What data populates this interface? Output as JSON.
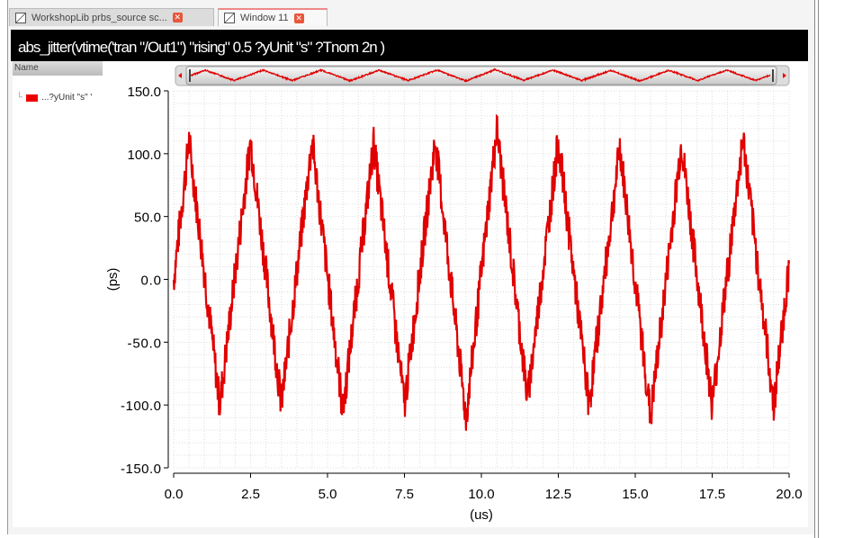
{
  "tabs": [
    {
      "label": "WorkshopLib prbs_source sc...",
      "active": false
    },
    {
      "label": "Window 11",
      "active": true
    }
  ],
  "title": "abs_jitter(vtime('tran \"/Out1\") \"rising\" 0.5 ?yUnit \"s\" ?Tnom 2n )",
  "legend_panel": {
    "header": "Name",
    "items": [
      {
        "label": "...?yUnit \"s\" '",
        "color": "#e00000"
      }
    ]
  },
  "chart_data": {
    "type": "line",
    "title": "abs_jitter(vtime('tran \"/Out1\") \"rising\" 0.5 ?yUnit \"s\" ?Tnom 2n )",
    "xlabel": "(us)",
    "ylabel": "(ps)",
    "xlim": [
      0,
      20
    ],
    "ylim": [
      -150,
      150
    ],
    "xticks": [
      "0.0",
      "2.5",
      "5.0",
      "7.5",
      "10.0",
      "12.5",
      "15.0",
      "17.5",
      "20.0"
    ],
    "yticks": [
      "150.0",
      "100.0",
      "50.0",
      "0.0",
      "-50.0",
      "-100.0",
      "-150.0"
    ],
    "grid": true,
    "series": [
      {
        "name": "...?yUnit \"s\" '",
        "color": "#e00000",
        "envelope_x": [
          0,
          0.5,
          1.5,
          2.5,
          3.5,
          4.5,
          5.5,
          6.5,
          7.5,
          8.5,
          9.5,
          10.5,
          11.5,
          12.5,
          13.5,
          14.5,
          15.5,
          16.5,
          17.5,
          18.5,
          19.5,
          20
        ],
        "envelope_y": [
          0,
          110,
          -100,
          110,
          -100,
          110,
          -105,
          108,
          -100,
          110,
          -110,
          120,
          -95,
          110,
          -100,
          105,
          -110,
          108,
          -100,
          112,
          -100,
          10
        ],
        "noise_pp": 30
      }
    ]
  }
}
